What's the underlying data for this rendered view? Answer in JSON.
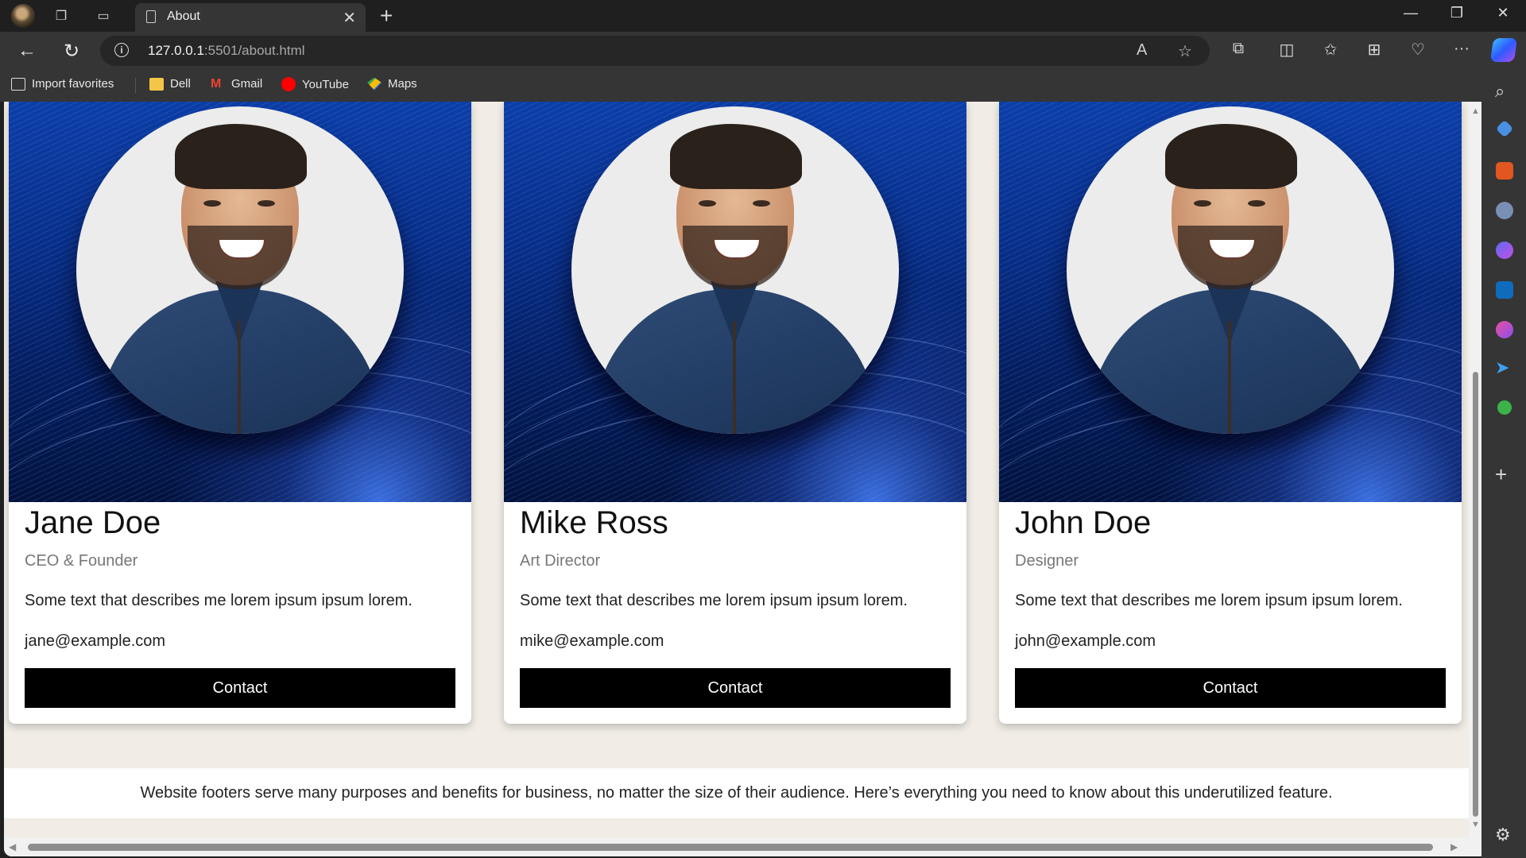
{
  "browser": {
    "tab_title": "About",
    "url_host": "127.0.0.1",
    "url_rest": ":5501/about.html"
  },
  "favorites": [
    {
      "label": "Import favorites",
      "icon": "import-icon"
    },
    {
      "label": "Dell",
      "icon": "folder-icon"
    },
    {
      "label": "Gmail",
      "icon": "gmail-icon"
    },
    {
      "label": "YouTube",
      "icon": "youtube-icon"
    },
    {
      "label": "Maps",
      "icon": "maps-icon"
    }
  ],
  "team": [
    {
      "name": "Jane Doe",
      "role": "CEO & Founder",
      "description": "Some text that describes me lorem ipsum ipsum lorem.",
      "email": "jane@example.com",
      "button": "Contact"
    },
    {
      "name": "Mike Ross",
      "role": "Art Director",
      "description": "Some text that describes me lorem ipsum ipsum lorem.",
      "email": "mike@example.com",
      "button": "Contact"
    },
    {
      "name": "John Doe",
      "role": "Designer",
      "description": "Some text that describes me lorem ipsum ipsum lorem.",
      "email": "john@example.com",
      "button": "Contact"
    }
  ],
  "footer": {
    "text": "Website footers serve many purposes and benefits for business, no matter the size of their audience. Here’s everything you need to know about this underutilized feature."
  },
  "colors": {
    "button_bg": "#000000",
    "page_bg": "#f1ede6",
    "hero_blue": "#0c3ea8"
  }
}
